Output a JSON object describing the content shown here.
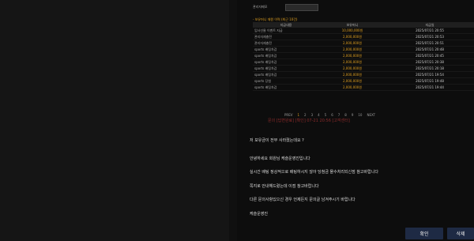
{
  "right_panel": {
    "note": {
      "label": "관리자메모",
      "input_value": ""
    },
    "table_title": "- 보유머니 재원 이력 (최근 10건)",
    "table": {
      "headers": [
        "지급내용",
        "보유머니",
        "지급일"
      ],
      "rows": [
        {
          "desc": "입사선물 이벤트 지급",
          "amount": "10,000,000원",
          "date": "2025/07/21 20:55"
        },
        {
          "desc": "관리자재충전",
          "amount": "2,000,000원",
          "date": "2025/07/21 20:53"
        },
        {
          "desc": "관리자재충전",
          "amount": "2,000,000원",
          "date": "2025/07/21 20:51"
        },
        {
          "desc": "sports 배팅차감",
          "amount": "2,000,000원",
          "date": "2025/07/21 20:48"
        },
        {
          "desc": "sports 배팅차감",
          "amount": "2,000,000원",
          "date": "2025/07/21 20:45"
        },
        {
          "desc": "sports 배팅차감",
          "amount": "2,000,000원",
          "date": "2025/07/21 20:38"
        },
        {
          "desc": "sports 배팅차감",
          "amount": "2,000,000원",
          "date": "2025/07/21 20:18"
        },
        {
          "desc": "sports 배팅차감",
          "amount": "2,000,000원",
          "date": "2025/07/21 19:54"
        },
        {
          "desc": "sports 당첨",
          "amount": "2,000,000원",
          "date": "2025/07/21 19:48"
        },
        {
          "desc": "sports 배팅차감",
          "amount": "2,000,000원",
          "date": "2025/07/21 19:44"
        }
      ]
    },
    "pager": {
      "prev": "PREV",
      "pages": [
        "1",
        "2",
        "3",
        "4",
        "5",
        "6",
        "7",
        "8",
        "9",
        "10"
      ],
      "active": "1",
      "next": "NEXT"
    },
    "messages": {
      "faded": "문의 [답변완료] [확인] 07-21 20:56 [고객센터]",
      "m1": "저 보유금이 전부 사라졌는데요 ?",
      "m2": "안녕하세요 회원님 케슬운영진입니다",
      "m3": "실시간 배팅 정상적으로 배팅하시지 않아 당첨금 몰수처리되신점 참고바랍니다",
      "m4": "쪽지로 안내해드렸는데 이점 참고바랍니다",
      "m5": "다른 문의사항있으신 경우 언제든지 문의글 남겨주시기 바랍니다",
      "m6": "케슬운영진"
    },
    "buttons": {
      "confirm": "확인",
      "delete": "삭제"
    }
  }
}
